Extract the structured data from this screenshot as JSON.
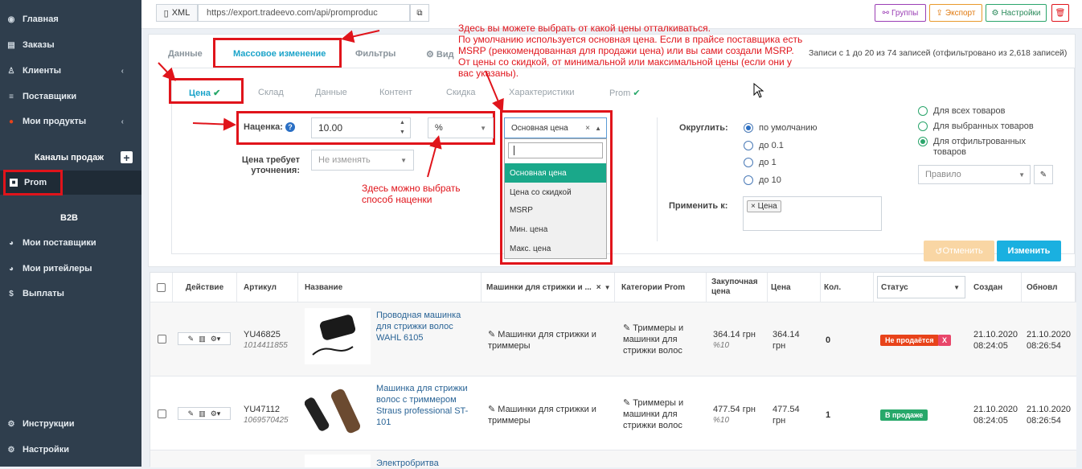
{
  "sidebar": {
    "items": [
      {
        "label": "Главная",
        "icon": "dashboard-icon",
        "chevron": false
      },
      {
        "label": "Заказы",
        "icon": "orders-icon",
        "chevron": false
      },
      {
        "label": "Клиенты",
        "icon": "user-icon",
        "chevron": true
      },
      {
        "label": "Поставщики",
        "icon": "database-icon",
        "chevron": false
      },
      {
        "label": "Мои продукты",
        "icon": "products-icon",
        "chevron": true
      }
    ],
    "channels_header": "Каналы продаж",
    "prom_label": "Prom",
    "b2b_header": "B2B",
    "b2b_items": [
      {
        "label": "Мои поставщики",
        "icon": "user-circle-icon"
      },
      {
        "label": "Мои ритейлеры",
        "icon": "user-circle-icon"
      },
      {
        "label": "Выплаты",
        "icon": "dollar-icon"
      }
    ],
    "bottom_items": [
      {
        "label": "Инструкции",
        "icon": "cogs-icon"
      },
      {
        "label": "Настройки",
        "icon": "settings-icon"
      }
    ]
  },
  "topbar": {
    "xml_label": "XML",
    "url": "https://export.tradeevo.com/api/promproduc",
    "groups_label": "Группы",
    "export_label": "Экспорт",
    "settings_label": "Настройки"
  },
  "panel": {
    "tabs": [
      "Данные",
      "Массовое изменение",
      "Фильтры",
      "Вид"
    ],
    "records_info": "Записи с 1 до 20 из 74 записей (отфильтровано из 2,618 записей)",
    "subtabs": [
      "Цена",
      "Склад",
      "Данные",
      "Контент",
      "Скидка",
      "Характеристики",
      "Prom"
    ],
    "markup_label": "Наценка:",
    "markup_value": "10.00",
    "markup_unit": "%",
    "clarify_label": "Цена требует уточнения:",
    "clarify_value": "Не изменять",
    "price_select": "Основная цена",
    "price_options": [
      "Основная цена",
      "Цена со скидкой",
      "MSRP",
      "Мин. цена",
      "Макс. цена"
    ],
    "round_label": "Округлить:",
    "round_options": [
      "по умолчанию",
      "до 0.1",
      "до 1",
      "до 10"
    ],
    "apply_label": "Применить к:",
    "apply_tag": "Цена",
    "scope_options": [
      "Для всех товаров",
      "Для выбранных товаров",
      "Для отфильтрованных товаров"
    ],
    "rule_placeholder": "Правило",
    "cancel_label": "Отменить",
    "change_label": "Изменить"
  },
  "annotations": {
    "top_note": "Здесь вы можете выбрать от какой цены отталкиваться.\nПо умолчанию используется основная цена. Если в прайсе поставщика есть MSRP (реккомендованная для продажи цена) или вы сами создали MSRP. От цены со скидкой, от минимальной или максимальной цены (если они у вас указаны).",
    "mid_note": "Здесь можно выбрать способ наценки"
  },
  "table": {
    "headers": [
      "Действие",
      "Артикул",
      "Название",
      "Машинки для стрижки и ...",
      "Категории Prom",
      "Закупочная цена",
      "Цена",
      "Кол.",
      "Статус",
      "Создан",
      "Обновл"
    ],
    "rows": [
      {
        "sku": "YU46825",
        "sku2": "1014411855",
        "name": "Проводная машинка для стрижки волос WAHL 6105",
        "cat": "Машинки для стрижки и триммеры",
        "prom": "Триммеры и машинки для стрижки волос",
        "cost": "364.14 грн",
        "cost_pct": "%10",
        "price": "364.14 грн",
        "qty": "0",
        "status": "Не продаётся",
        "status_color": "#e8431a",
        "created": "21.10.2020 08:24:05",
        "updated": "21.10.2020 08:26:54"
      },
      {
        "sku": "YU47112",
        "sku2": "1069570425",
        "name": "Машинка для стрижки волос с триммером Straus professional ST-101",
        "cat": "Машинки для стрижки и триммеры",
        "prom": "Триммеры и машинки для стрижки волос",
        "cost": "477.54 грн",
        "cost_pct": "%10",
        "price": "477.54 грн",
        "qty": "1",
        "status": "В продаже",
        "status_color": "#27a86a",
        "created": "21.10.2020 08:24:05",
        "updated": "21.10.2020 08:26:54"
      },
      {
        "name": "Электробритва"
      }
    ]
  },
  "colors": {
    "sidebar_bg": "#2f3e4d",
    "accent_red": "#e0141b",
    "primary": "#1ab0e0",
    "active_tab": "#1aa3c9"
  }
}
